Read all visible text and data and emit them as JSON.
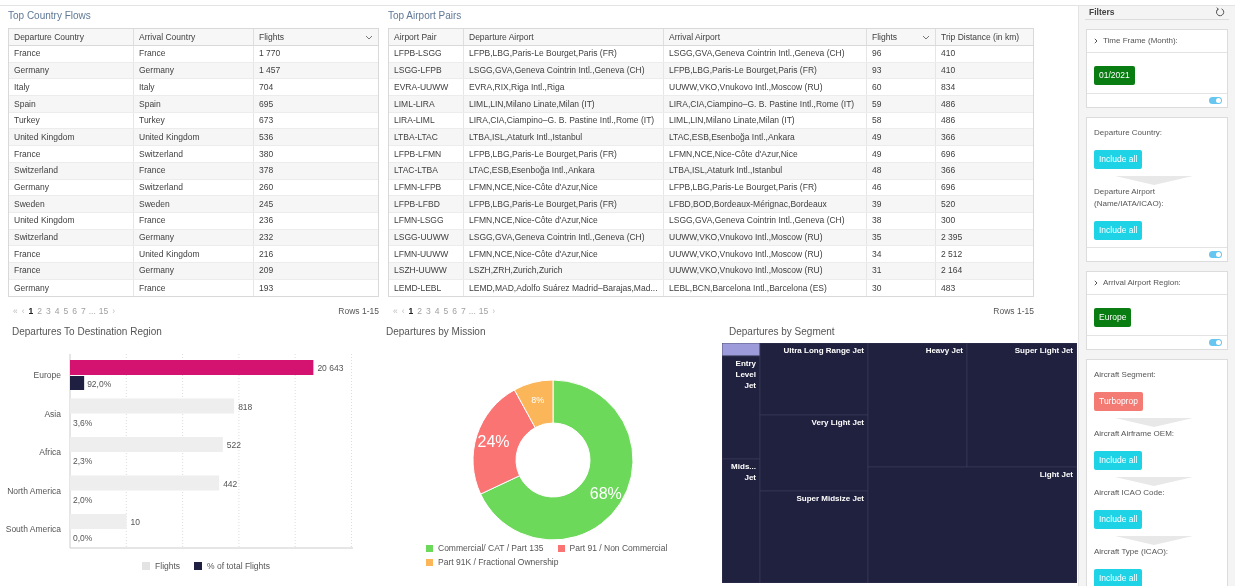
{
  "country_flows": {
    "title": "Top Country Flows",
    "columns": [
      {
        "label": "Departure Country",
        "sorted": false
      },
      {
        "label": "Arrival Country",
        "sorted": false
      },
      {
        "label": "Flights",
        "sorted": true
      }
    ],
    "rows": [
      [
        "France",
        "France",
        "1 770"
      ],
      [
        "Germany",
        "Germany",
        "1 457"
      ],
      [
        "Italy",
        "Italy",
        "704"
      ],
      [
        "Spain",
        "Spain",
        "695"
      ],
      [
        "Turkey",
        "Turkey",
        "673"
      ],
      [
        "United Kingdom",
        "United Kingdom",
        "536"
      ],
      [
        "France",
        "Switzerland",
        "380"
      ],
      [
        "Switzerland",
        "France",
        "378"
      ],
      [
        "Germany",
        "Switzerland",
        "260"
      ],
      [
        "Sweden",
        "Sweden",
        "245"
      ],
      [
        "United Kingdom",
        "France",
        "236"
      ],
      [
        "Switzerland",
        "Germany",
        "232"
      ],
      [
        "France",
        "United Kingdom",
        "216"
      ],
      [
        "France",
        "Germany",
        "209"
      ],
      [
        "Germany",
        "France",
        "193"
      ]
    ],
    "pagination": {
      "first": "«",
      "prev": "‹",
      "pages": [
        {
          "label": "1",
          "selected": true
        },
        {
          "label": "2",
          "selected": false
        },
        {
          "label": "3",
          "selected": false
        },
        {
          "label": "4",
          "selected": false
        },
        {
          "label": "5",
          "selected": false
        },
        {
          "label": "6",
          "selected": false
        },
        {
          "label": "7",
          "selected": false
        }
      ],
      "ellipsis": "...",
      "last": "15",
      "next": "›"
    },
    "rows_info": "Rows 1-15"
  },
  "airport_pairs": {
    "title": "Top Airport Pairs",
    "columns": [
      {
        "label": "Airport Pair",
        "sorted": false
      },
      {
        "label": "Departure Airport",
        "sorted": false
      },
      {
        "label": "Arrival Airport",
        "sorted": false
      },
      {
        "label": "Flights",
        "sorted": true
      },
      {
        "label": "Trip Distance (in km)",
        "sorted": false
      }
    ],
    "rows": [
      [
        "LFPB-LSGG",
        "LFPB,LBG,Paris-Le Bourget,Paris (FR)",
        "LSGG,GVA,Geneva Cointrin Intl.,Geneva (CH)",
        "96",
        "410"
      ],
      [
        "LSGG-LFPB",
        "LSGG,GVA,Geneva Cointrin Intl.,Geneva (CH)",
        "LFPB,LBG,Paris-Le Bourget,Paris (FR)",
        "93",
        "410"
      ],
      [
        "EVRA-UUWW",
        "EVRA,RIX,Riga Intl.,Riga",
        "UUWW,VKO,Vnukovo Intl.,Moscow (RU)",
        "60",
        "834"
      ],
      [
        "LIML-LIRA",
        "LIML,LIN,Milano Linate,Milan (IT)",
        "LIRA,CIA,Ciampino–G. B. Pastine Intl.,Rome (IT)",
        "59",
        "486"
      ],
      [
        "LIRA-LIML",
        "LIRA,CIA,Ciampino–G. B. Pastine Intl.,Rome (IT)",
        "LIML,LIN,Milano Linate,Milan (IT)",
        "58",
        "486"
      ],
      [
        "LTBA-LTAC",
        "LTBA,ISL,Ataturk Intl.,Istanbul",
        "LTAC,ESB,Esenboğa Intl.,Ankara",
        "49",
        "366"
      ],
      [
        "LFPB-LFMN",
        "LFPB,LBG,Paris-Le Bourget,Paris (FR)",
        "LFMN,NCE,Nice-Côte d'Azur,Nice",
        "49",
        "696"
      ],
      [
        "LTAC-LTBA",
        "LTAC,ESB,Esenboğa Intl.,Ankara",
        "LTBA,ISL,Ataturk Intl.,Istanbul",
        "48",
        "366"
      ],
      [
        "LFMN-LFPB",
        "LFMN,NCE,Nice-Côte d'Azur,Nice",
        "LFPB,LBG,Paris-Le Bourget,Paris (FR)",
        "46",
        "696"
      ],
      [
        "LFPB-LFBD",
        "LFPB,LBG,Paris-Le Bourget,Paris (FR)",
        "LFBD,BOD,Bordeaux-Mérignac,Bordeaux",
        "39",
        "520"
      ],
      [
        "LFMN-LSGG",
        "LFMN,NCE,Nice-Côte d'Azur,Nice",
        "LSGG,GVA,Geneva Cointrin Intl.,Geneva (CH)",
        "38",
        "300"
      ],
      [
        "LSGG-UUWW",
        "LSGG,GVA,Geneva Cointrin Intl.,Geneva (CH)",
        "UUWW,VKO,Vnukovo Intl.,Moscow (RU)",
        "35",
        "2 395"
      ],
      [
        "LFMN-UUWW",
        "LFMN,NCE,Nice-Côte d'Azur,Nice",
        "UUWW,VKO,Vnukovo Intl.,Moscow (RU)",
        "34",
        "2 512"
      ],
      [
        "LSZH-UUWW",
        "LSZH,ZRH,Zurich,Zurich",
        "UUWW,VKO,Vnukovo Intl.,Moscow (RU)",
        "31",
        "2 164"
      ],
      [
        "LEMD-LEBL",
        "LEMD,MAD,Adolfo Suárez Madrid–Barajas,Mad...",
        "LEBL,BCN,Barcelona Intl.,Barcelona (ES)",
        "30",
        "483"
      ]
    ],
    "pagination": {
      "first": "«",
      "prev": "‹",
      "pages": [
        {
          "label": "1",
          "selected": true
        },
        {
          "label": "2",
          "selected": false
        },
        {
          "label": "3",
          "selected": false
        },
        {
          "label": "4",
          "selected": false
        },
        {
          "label": "5",
          "selected": false
        },
        {
          "label": "6",
          "selected": false
        },
        {
          "label": "7",
          "selected": false
        }
      ],
      "ellipsis": "...",
      "last": "15",
      "next": "›"
    },
    "rows_info": "Rows 1-15"
  },
  "region_chart": {
    "title": "Departures To Destination Region",
    "rows": [
      {
        "label": "Europe",
        "flights": {
          "text": "20 643",
          "level": 0.86,
          "highlighted": true
        },
        "share": {
          "text": "92,0%",
          "level": 0.05
        }
      },
      {
        "label": "Asia",
        "flights": {
          "text": "818",
          "level": 0.58,
          "highlighted": false
        },
        "share": {
          "text": "3,6%"
        }
      },
      {
        "label": "Africa",
        "flights": {
          "text": "522",
          "level": 0.54,
          "highlighted": false
        },
        "share": {
          "text": "2,3%"
        }
      },
      {
        "label": "North America",
        "flights": {
          "text": "442",
          "level": 0.527,
          "highlighted": false
        },
        "share": {
          "text": "2,0%"
        }
      },
      {
        "label": "South America",
        "flights": {
          "text": "10",
          "level": 0.2,
          "highlighted": false
        },
        "share": {
          "text": "0,0%"
        }
      }
    ],
    "legend": [
      {
        "label": "Flights",
        "color": "#e3e3e3"
      },
      {
        "label": "% of total Flights",
        "color": "#1f2041"
      }
    ]
  },
  "mission_chart": {
    "title": "Departures by Mission",
    "chart_data": {
      "type": "donut",
      "categories": [
        "Commercial/ CAT / Part 135",
        "Part 91 / Non Commercial",
        "Part 91K / Fractional Ownership"
      ],
      "series": [
        {
          "colors": [
            "#6dd95a",
            "#fb7474",
            "#fbb65a"
          ],
          "values": [
            68,
            24,
            8
          ],
          "value_labels": [
            "68%",
            "24%",
            "8%"
          ]
        }
      ]
    }
  },
  "segment_treemap": {
    "title": "Departures by Segment",
    "tiles": [
      {
        "selected": true
      },
      {
        "label": "Entry Level Jet",
        "selected": false
      },
      {
        "label": "Mids... Jet",
        "selected": false
      },
      {
        "label": "Ultra Long Range Jet",
        "selected": false
      },
      {
        "label": "Very Light Jet",
        "selected": false
      },
      {
        "label": "Super Midsize Jet",
        "selected": false
      },
      {
        "label": "Heavy Jet",
        "selected": false
      },
      {
        "label": "Super Light Jet",
        "selected": false
      },
      {
        "label": "Light Jet",
        "selected": false
      }
    ]
  },
  "filters": {
    "title": "Filters",
    "groups": [
      {
        "toggle": {
          "on": true
        },
        "filters": [
          {
            "label": "Time Frame (Month):",
            "collapsible": true,
            "chip": {
              "text": "01/2021",
              "kind": "selected"
            }
          }
        ]
      },
      {
        "toggle": {
          "on": true
        },
        "filters": [
          {
            "label": "Departure Country:",
            "collapsible": false,
            "chip": {
              "text": "Include all",
              "kind": "include_all"
            }
          },
          {
            "label": "Departure Airport (Name/IATA/ICAO):",
            "collapsible": false,
            "chip": {
              "text": "Include all",
              "kind": "include_all"
            }
          }
        ]
      },
      {
        "toggle": {
          "on": true
        },
        "filters": [
          {
            "label": "Arrival Airport Region:",
            "collapsible": true,
            "chip": {
              "text": "Europe",
              "kind": "selected"
            }
          }
        ]
      },
      {
        "filters": [
          {
            "label": "Aircraft Segment:",
            "collapsible": false,
            "chip": {
              "text": "Turboprop",
              "kind": "excluded"
            }
          },
          {
            "label": "Aircraft Airframe OEM:",
            "collapsible": false,
            "chip": {
              "text": "Include all",
              "kind": "include_all"
            }
          },
          {
            "label": "Aircraft ICAO Code:",
            "collapsible": false,
            "chip": {
              "text": "Include all",
              "kind": "include_all"
            }
          },
          {
            "label": "Aircraft Type (ICAO):",
            "collapsible": false,
            "chip": {
              "text": "Include all",
              "kind": "include_all"
            }
          }
        ]
      }
    ]
  }
}
